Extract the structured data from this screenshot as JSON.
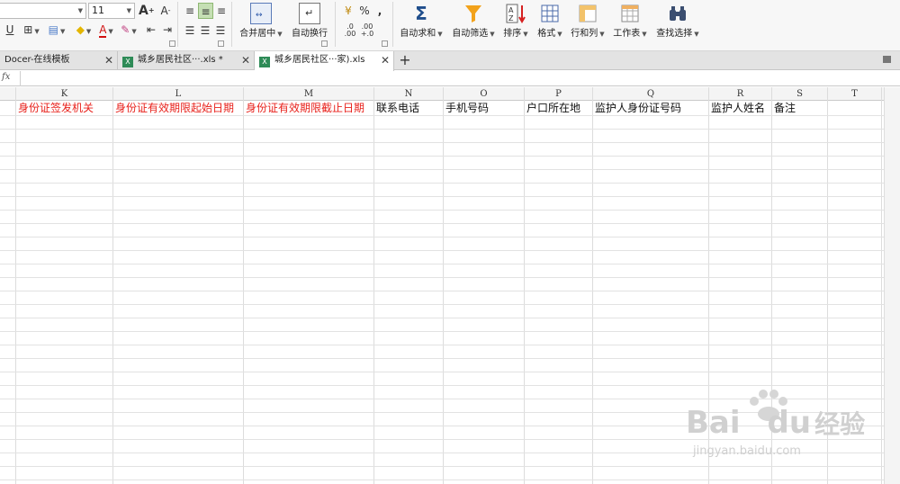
{
  "ribbon": {
    "font_size": "11",
    "merge_center": "合并居中",
    "wrap_text": "自动换行",
    "auto_sum": "自动求和",
    "auto_filter": "自动筛选",
    "sort": "排序",
    "format": "格式",
    "row_col": "行和列",
    "worksheet": "工作表",
    "find_select": "查找选择",
    "percent": "%",
    "comma": ",",
    "inc_decimal_top": ".0",
    "inc_decimal_bottom": ".00",
    "dec_decimal_top": ".00",
    "dec_decimal_bottom": "+.0",
    "font_grow": "A",
    "font_shrink": "A",
    "underline": "U",
    "font_color_letter": "A"
  },
  "tabs": [
    {
      "label": "Docer-在线模板",
      "active": false
    },
    {
      "label": "城乡居民社区···.xls *",
      "active": false
    },
    {
      "label": "城乡居民社区···家).xls",
      "active": true
    }
  ],
  "formula_bar": {
    "fx": "fx",
    "value": ""
  },
  "columns": [
    "K",
    "L",
    "M",
    "N",
    "O",
    "P",
    "Q",
    "R",
    "S",
    "T"
  ],
  "row1": [
    {
      "text": "身份证签发机关",
      "color": "#e8221c"
    },
    {
      "text": "身份证有效期限起始日期",
      "color": "#e8221c"
    },
    {
      "text": "身份证有效期限截止日期",
      "color": "#e8221c"
    },
    {
      "text": "联系电话",
      "color": "#111111"
    },
    {
      "text": "手机号码",
      "color": "#111111"
    },
    {
      "text": "户口所在地",
      "color": "#111111"
    },
    {
      "text": "监护人身份证号码",
      "color": "#111111"
    },
    {
      "text": "监护人姓名",
      "color": "#111111"
    },
    {
      "text": "备注",
      "color": "#111111"
    },
    {
      "text": "",
      "color": "#111111"
    }
  ],
  "watermark": {
    "brand_a": "Bai",
    "brand_b": "du",
    "brand_c": "经验",
    "url": "jingyan.baidu.com"
  }
}
